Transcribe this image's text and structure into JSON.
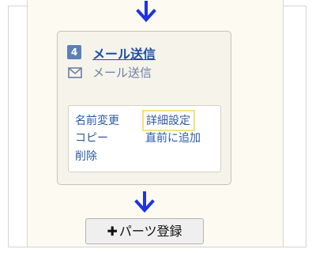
{
  "card": {
    "step_number": "4",
    "title": "メール送信",
    "subtitle": "メール送信",
    "actions": {
      "rename": "名前変更",
      "copy": "コピー",
      "delete": "削除",
      "detail_settings": "詳細設定",
      "add_before": "直前に追加"
    }
  },
  "add_parts_button": {
    "icon": "✚",
    "label": "パーツ登録"
  },
  "icons": {
    "arrow": "arrow-down-icon",
    "mail": "envelope-icon",
    "plus": "plus-icon"
  },
  "colors": {
    "arrow": "#1f33e0",
    "badge": "#5b81b6",
    "link": "#2b5aa8",
    "title": "#1d4ea3",
    "highlight": "#f3e07a",
    "canvas": "#fcfaf1"
  }
}
